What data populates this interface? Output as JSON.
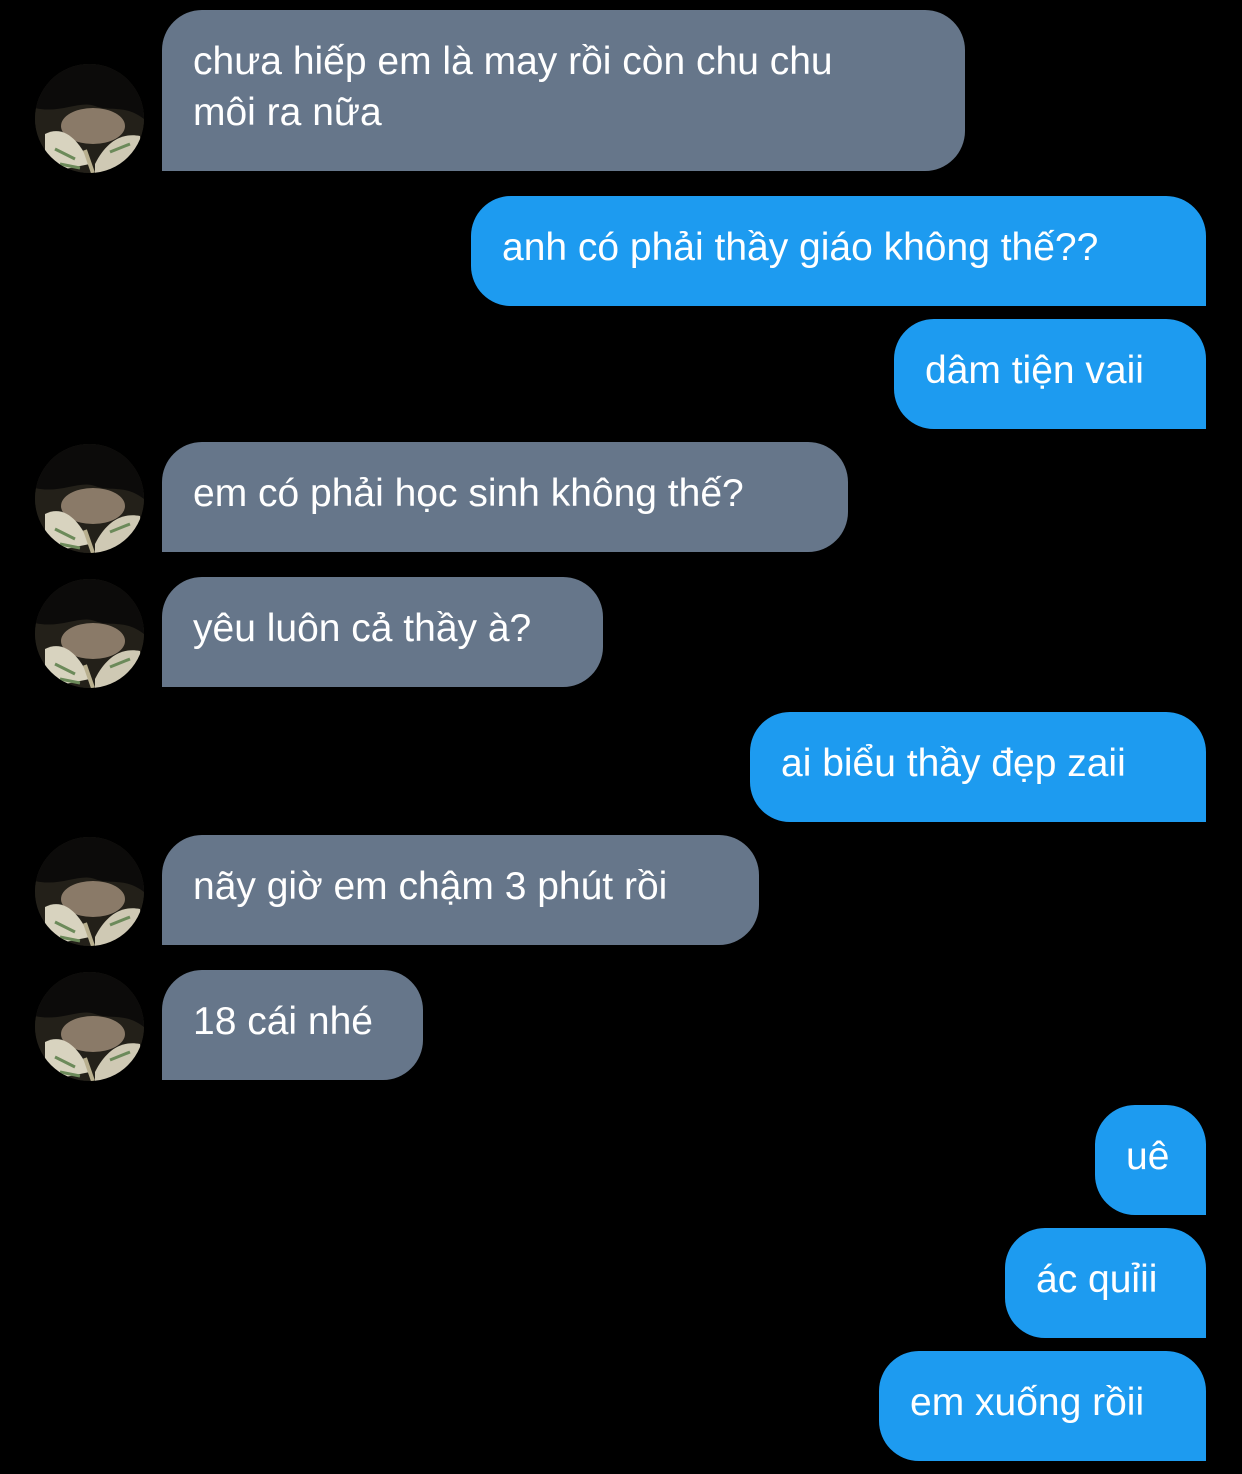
{
  "colors": {
    "background": "#000000",
    "incoming": "#66768A",
    "outgoing": "#1D9BF0",
    "text": "#FFFFFF"
  },
  "messages": [
    {
      "side": "in",
      "text": "chưa hiếp em là may rồi còn chu chu",
      "text2": "môi ra nữa"
    },
    {
      "side": "out",
      "text": "anh có phải thầy giáo không thế??"
    },
    {
      "side": "out",
      "text": "dâm tiện vaii"
    },
    {
      "side": "in",
      "text": "em có phải học sinh không thế?"
    },
    {
      "side": "in",
      "text": "yêu luôn cả thầy à?"
    },
    {
      "side": "out",
      "text": "ai biểu thầy đẹp zaii"
    },
    {
      "side": "in",
      "text": "nãy giờ em chậm 3 phút rồi"
    },
    {
      "side": "in",
      "text": "18 cái nhé"
    },
    {
      "side": "out",
      "text": "uê"
    },
    {
      "side": "out",
      "text": "ác quỉii"
    },
    {
      "side": "out",
      "text": "em xuống rồii"
    }
  ]
}
